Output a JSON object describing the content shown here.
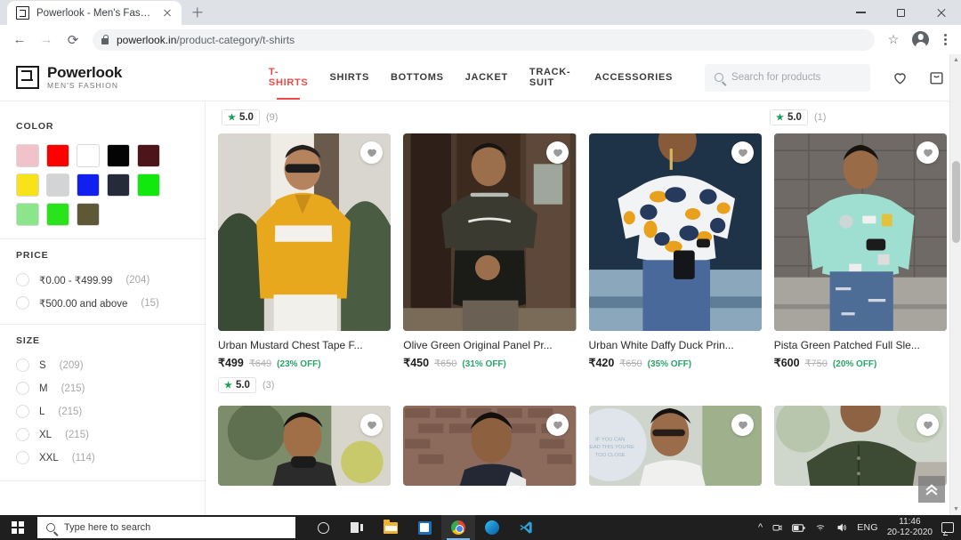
{
  "browser": {
    "tab": {
      "title": "Powerlook - Men's Fashion",
      "favicon_icon": "powerlook-logo-icon",
      "close_icon": "close-icon"
    },
    "new_tab_icon": "plus-icon",
    "window_controls": {
      "minimize_icon": "minimize-icon",
      "maximize_icon": "maximize-icon",
      "close_icon": "close-icon"
    },
    "nav": {
      "back_icon": "arrow-left-icon",
      "forward_icon": "arrow-right-icon",
      "reload_icon": "reload-icon"
    },
    "omnibox": {
      "lock_icon": "lock-icon",
      "url_domain": "powerlook.in",
      "url_path": "/product-category/t-shirts"
    },
    "actions": {
      "bookmark_icon": "star-icon",
      "profile_icon": "account-avatar-icon",
      "menu_icon": "kebab-menu-icon"
    }
  },
  "site": {
    "logo": {
      "name": "Powerlook",
      "tagline": "MEN'S FASHION",
      "mark_icon": "powerlook-monogram-icon"
    },
    "nav_items": [
      {
        "label": "T-SHIRTS",
        "active": true
      },
      {
        "label": "SHIRTS",
        "active": false
      },
      {
        "label": "BOTTOMS",
        "active": false
      },
      {
        "label": "JACKET",
        "active": false
      },
      {
        "label": "TRACK-SUIT",
        "active": false
      },
      {
        "label": "ACCESSORIES",
        "active": false
      }
    ],
    "search": {
      "placeholder": "Search for products",
      "icon": "search-icon"
    },
    "header_icons": [
      {
        "name": "wishlist-icon"
      },
      {
        "name": "shopping-bag-icon"
      }
    ]
  },
  "sidebar": {
    "color": {
      "title": "COLOR",
      "swatches": [
        {
          "name": "pink",
          "hex": "#f2c2ca"
        },
        {
          "name": "red",
          "hex": "#fe0000"
        },
        {
          "name": "white",
          "hex": "#ffffff"
        },
        {
          "name": "black",
          "hex": "#040404"
        },
        {
          "name": "maroon",
          "hex": "#4b1519"
        },
        {
          "name": "yellow",
          "hex": "#f7e318"
        },
        {
          "name": "light-grey",
          "hex": "#d2d4d6"
        },
        {
          "name": "blue",
          "hex": "#1021ef"
        },
        {
          "name": "navy",
          "hex": "#252b38"
        },
        {
          "name": "green",
          "hex": "#11e80d"
        },
        {
          "name": "pista-green",
          "hex": "#8be58a"
        },
        {
          "name": "bright-green",
          "hex": "#2ae41b"
        },
        {
          "name": "olive",
          "hex": "#5e5836"
        }
      ]
    },
    "price": {
      "title": "PRICE",
      "options": [
        {
          "label": "₹0.00 - ₹499.99",
          "count": "(204)"
        },
        {
          "label": "₹500.00 and above",
          "count": "(15)"
        }
      ]
    },
    "size": {
      "title": "SIZE",
      "options": [
        {
          "label": "S",
          "count": "(209)"
        },
        {
          "label": "M",
          "count": "(215)"
        },
        {
          "label": "L",
          "count": "(215)"
        },
        {
          "label": "XL",
          "count": "(215)"
        },
        {
          "label": "XXL",
          "count": "(114)"
        }
      ]
    }
  },
  "main": {
    "top_ratings": [
      {
        "col": 1,
        "value": "5.0",
        "count": "(9)",
        "star_icon": "star-icon"
      },
      {
        "col": 4,
        "value": "5.0",
        "count": "(1)",
        "star_icon": "star-icon"
      }
    ],
    "products": [
      {
        "title": "Urban Mustard Chest Tape F...",
        "price": "₹499",
        "was": "₹649",
        "discount": "(23% OFF)",
        "rating": {
          "value": "5.0",
          "count": "(3)",
          "star_icon": "star-icon"
        },
        "wishlist_icon": "heart-icon",
        "image_alt": "man-in-mustard-chest-tape-full-sleeve-tshirt"
      },
      {
        "title": "Olive Green Original Panel Pr...",
        "price": "₹450",
        "was": "₹650",
        "discount": "(31% OFF)",
        "rating": null,
        "wishlist_icon": "heart-icon",
        "image_alt": "man-in-olive-green-panel-print-tshirt"
      },
      {
        "title": "Urban White Daffy Duck Prin...",
        "price": "₹420",
        "was": "₹650",
        "discount": "(35% OFF)",
        "rating": null,
        "wishlist_icon": "heart-icon",
        "image_alt": "man-in-white-daffy-duck-print-tshirt"
      },
      {
        "title": "Pista Green Patched Full Sle...",
        "price": "₹600",
        "was": "₹750",
        "discount": "(20% OFF)",
        "rating": null,
        "wishlist_icon": "heart-icon",
        "image_alt": "man-in-pista-green-patched-full-sleeve-tshirt"
      }
    ],
    "products_row2": [
      {
        "wishlist_icon": "heart-icon",
        "image_alt": "man-in-black-turtleneck-outdoors"
      },
      {
        "wishlist_icon": "heart-icon",
        "image_alt": "man-in-navy-tshirt-brick-wall"
      },
      {
        "wishlist_icon": "heart-icon",
        "image_alt": "man-in-white-graphic-tshirt-sunglasses"
      },
      {
        "wishlist_icon": "heart-icon",
        "image_alt": "man-in-olive-green-henley-shirt"
      }
    ],
    "scroll_top_icon": "double-chevron-up-icon"
  },
  "taskbar": {
    "start_icon": "windows-start-icon",
    "search_placeholder": "Type here to search",
    "search_icon": "search-icon",
    "items": [
      {
        "name": "cortana-icon"
      },
      {
        "name": "task-view-icon"
      },
      {
        "name": "file-explorer-icon"
      },
      {
        "name": "microsoft-store-icon"
      },
      {
        "name": "google-chrome-icon"
      },
      {
        "name": "microsoft-edge-icon"
      },
      {
        "name": "visual-studio-code-icon"
      }
    ],
    "tray": {
      "overflow_icon": "chevron-up-icon",
      "icons": [
        "camera-icon",
        "battery-icon",
        "wifi-icon",
        "volume-icon"
      ],
      "language": "ENG",
      "time": "11:46",
      "date": "20-12-2020",
      "action_center_icon": "notification-icon"
    }
  }
}
